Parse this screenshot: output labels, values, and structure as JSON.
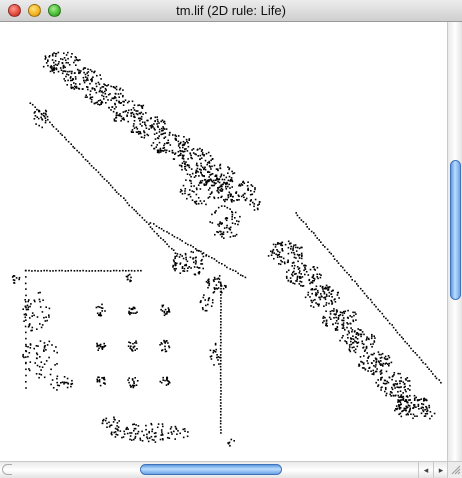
{
  "window": {
    "title": "tm.lif (2D rule: Life)"
  },
  "scrollbars": {
    "horizontal_arrows": {
      "left": "◂",
      "right": "▸"
    }
  },
  "colors": {
    "cells": "#000000",
    "background": "#ffffff",
    "scroll_thumb": "#6aa3e6"
  },
  "icons": {
    "close": "close-button",
    "minimize": "minimize-button",
    "zoom": "zoom-button",
    "resize": "resize-grip-icon"
  }
}
